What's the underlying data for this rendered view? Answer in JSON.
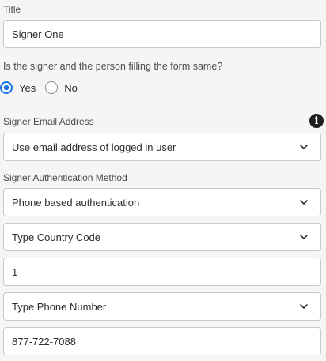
{
  "title_field": {
    "label": "Title",
    "value": "Signer One"
  },
  "same_person": {
    "question": "Is the signer and the person filling the form same?",
    "options": [
      {
        "label": "Yes",
        "selected": true
      },
      {
        "label": "No",
        "selected": false
      }
    ]
  },
  "email": {
    "label": "Signer Email Address",
    "info_icon": "info-icon",
    "selected": "Use email address of logged in user"
  },
  "auth": {
    "label": "Signer Authentication Method",
    "method": "Phone based authentication",
    "country_code_placeholder": "Type Country Code",
    "country_code_value": "1",
    "phone_placeholder": "Type Phone Number",
    "phone_value": "877-722-7088"
  },
  "colors": {
    "accent": "#1473e6",
    "background": "#f5f5f5",
    "border": "#c8c8c8"
  }
}
